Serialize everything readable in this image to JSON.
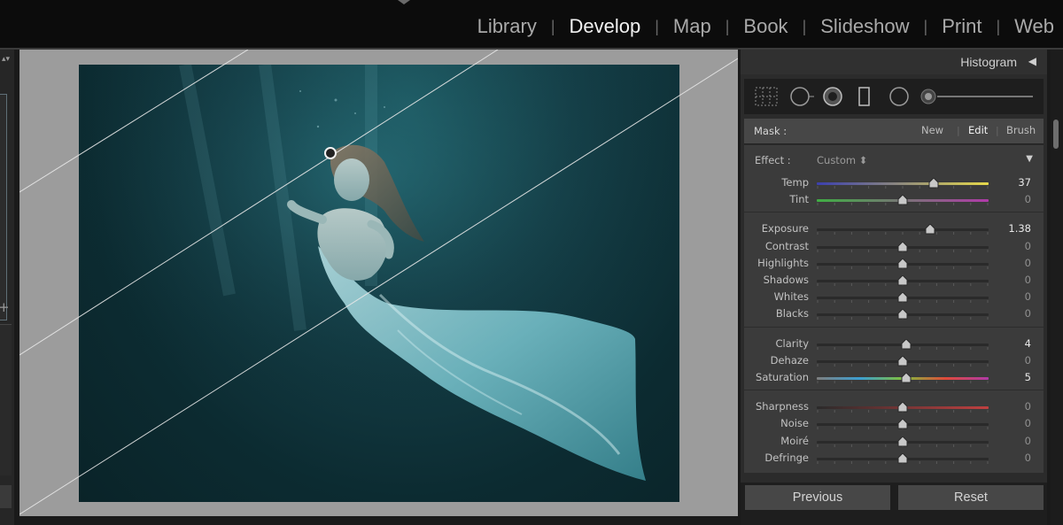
{
  "top_nav": {
    "modules": [
      "Library",
      "Develop",
      "Map",
      "Book",
      "Slideshow",
      "Print",
      "Web"
    ],
    "active": "Develop"
  },
  "right_panel": {
    "histogram_label": "Histogram",
    "mask": {
      "label": "Mask :",
      "options": [
        "New",
        "Edit",
        "Brush"
      ],
      "active": "Edit"
    },
    "effect": {
      "label": "Effect :",
      "value": "Custom"
    },
    "groups": [
      [
        {
          "label": "Temp",
          "value": "37",
          "position": 0.68,
          "gradient": "temp"
        },
        {
          "label": "Tint",
          "value": "0",
          "position": 0.5,
          "gradient": "tint"
        }
      ],
      [
        {
          "label": "Exposure",
          "value": "1.38",
          "position": 0.66
        },
        {
          "label": "Contrast",
          "value": "0",
          "position": 0.5
        },
        {
          "label": "Highlights",
          "value": "0",
          "position": 0.5
        },
        {
          "label": "Shadows",
          "value": "0",
          "position": 0.5
        },
        {
          "label": "Whites",
          "value": "0",
          "position": 0.5
        },
        {
          "label": "Blacks",
          "value": "0",
          "position": 0.5
        }
      ],
      [
        {
          "label": "Clarity",
          "value": "4",
          "position": 0.52
        },
        {
          "label": "Dehaze",
          "value": "0",
          "position": 0.5
        },
        {
          "label": "Saturation",
          "value": "5",
          "position": 0.52,
          "gradient": "saturation"
        }
      ],
      [
        {
          "label": "Sharpness",
          "value": "0",
          "position": 0.5,
          "gradient": "sharpness"
        },
        {
          "label": "Noise",
          "value": "0",
          "position": 0.5
        },
        {
          "label": "Moiré",
          "value": "0",
          "position": 0.5
        },
        {
          "label": "Defringe",
          "value": "0",
          "position": 0.5
        }
      ]
    ],
    "buttons": {
      "previous": "Previous",
      "reset": "Reset"
    }
  },
  "colors": {
    "temp_gradient": [
      "#3b3fae",
      "#e5d84a"
    ],
    "tint_gradient": [
      "#3fae43",
      "#b03aa8"
    ],
    "saturation_gradient": [
      "#7f7f7f",
      "#3c9fd2",
      "#7fbf3c",
      "#e04a3a",
      "#b03aa8"
    ],
    "sharpness_gradient": [
      "#2a2a2a",
      "#c04040"
    ]
  }
}
